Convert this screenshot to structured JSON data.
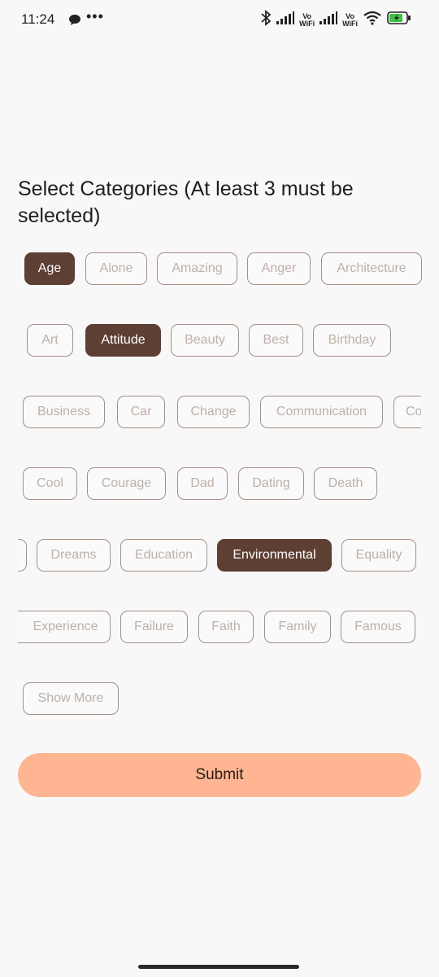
{
  "status_bar": {
    "time": "11:24",
    "dots": "•••",
    "vo_wifi_1": "Vo\nWiFi",
    "vo_wifi_2": "Vo\nWiFi"
  },
  "title": "Select Categories (At least 3 must be selected)",
  "categories": [
    {
      "label": "Age",
      "selected": true
    },
    {
      "label": "Alone",
      "selected": false
    },
    {
      "label": "Amazing",
      "selected": false
    },
    {
      "label": "Anger",
      "selected": false
    },
    {
      "label": "Architecture",
      "selected": false
    },
    {
      "label": "Art",
      "selected": false
    },
    {
      "label": "Attitude",
      "selected": true
    },
    {
      "label": "Beauty",
      "selected": false
    },
    {
      "label": "Best",
      "selected": false
    },
    {
      "label": "Birthday",
      "selected": false
    },
    {
      "label": "Business",
      "selected": false
    },
    {
      "label": "Car",
      "selected": false
    },
    {
      "label": "Change",
      "selected": false
    },
    {
      "label": "Communication",
      "selected": false
    },
    {
      "label": "Co",
      "selected": false
    },
    {
      "label": "Cool",
      "selected": false
    },
    {
      "label": "Courage",
      "selected": false
    },
    {
      "label": "Dad",
      "selected": false
    },
    {
      "label": "Dating",
      "selected": false
    },
    {
      "label": "Death",
      "selected": false
    },
    {
      "label": "Dreams",
      "selected": false
    },
    {
      "label": "Education",
      "selected": false
    },
    {
      "label": "Environmental",
      "selected": true
    },
    {
      "label": "Equality",
      "selected": false
    },
    {
      "label": "Experience",
      "selected": false
    },
    {
      "label": "Failure",
      "selected": false
    },
    {
      "label": "Faith",
      "selected": false
    },
    {
      "label": "Family",
      "selected": false
    },
    {
      "label": "Famous",
      "selected": false
    }
  ],
  "show_more": "Show More",
  "submit": "Submit",
  "colors": {
    "selected": "#5d3f33",
    "submit": "#ffb592",
    "border": "#a68f85"
  }
}
